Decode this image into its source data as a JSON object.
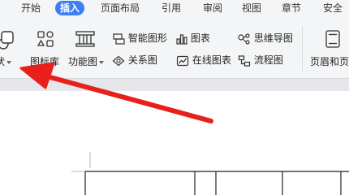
{
  "tabs": [
    {
      "label": "开始"
    },
    {
      "label": "插入"
    },
    {
      "label": "页面布局"
    },
    {
      "label": "引用"
    },
    {
      "label": "审阅"
    },
    {
      "label": "视图"
    },
    {
      "label": "章节"
    },
    {
      "label": "安全"
    }
  ],
  "ribbon": {
    "shape_label": "状",
    "icon_lib_label": "图标库",
    "function_chart_label": "功能图",
    "smart_graphic_label": "智能图形",
    "chart_label": "图表",
    "mind_map_label": "思维导图",
    "relation_label": "关系图",
    "online_chart_label": "在线图表",
    "flowchart_label": "流程图",
    "header_footer_label": "页眉和页"
  },
  "colors": {
    "accent": "#3d7ef5",
    "arrow": "#e8201c"
  }
}
